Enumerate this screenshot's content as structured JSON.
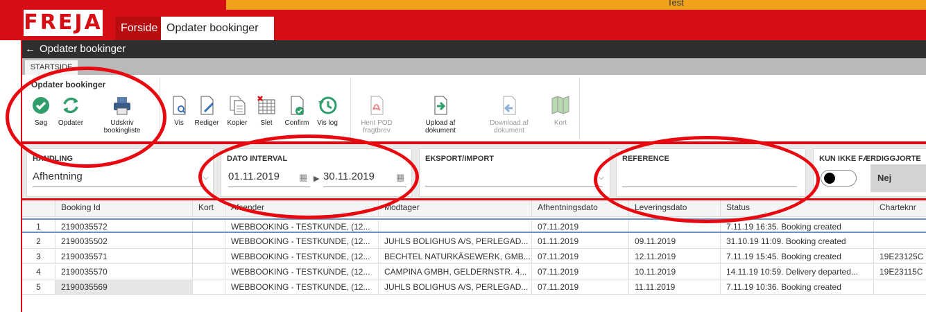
{
  "env": {
    "label": "Test"
  },
  "app": {
    "logo": "FREJA"
  },
  "app_tabs": [
    {
      "label": "Forside"
    },
    {
      "label": "Opdater bookinger"
    }
  ],
  "titlebar": {
    "back_icon": "arrow-left-icon",
    "title": "Opdater bookinger"
  },
  "ribbon": {
    "tab": "STARTSIDE",
    "group_label": "Opdater bookinger",
    "buttons": [
      {
        "label": "Søg",
        "icon": "check-circle-icon",
        "color": "#2f9e6b"
      },
      {
        "label": "Opdater",
        "icon": "refresh-icon",
        "color": "#2f9e6b"
      },
      {
        "label": "Udskriv bookingliste",
        "icon": "printer-icon"
      },
      {
        "label": "Vis",
        "icon": "document-search-icon"
      },
      {
        "label": "Rediger",
        "icon": "document-edit-icon"
      },
      {
        "label": "Kopier",
        "icon": "copy-icon"
      },
      {
        "label": "Slet",
        "icon": "table-delete-icon"
      },
      {
        "label": "Confirm",
        "icon": "document-check-icon"
      },
      {
        "label": "Vis log",
        "icon": "history-icon"
      },
      {
        "label": "Hent POD fragtbrev",
        "icon": "pdf-icon",
        "disabled": true
      },
      {
        "label": "Upload af dokument",
        "icon": "document-upload-icon"
      },
      {
        "label": "Download af dokument",
        "icon": "document-download-icon",
        "disabled": true
      },
      {
        "label": "Kort",
        "icon": "map-icon",
        "disabled": true
      }
    ]
  },
  "filters": {
    "handling": {
      "label": "HANDLING",
      "value": "Afhentning"
    },
    "dato": {
      "label": "DATO INTERVAL",
      "from": "01.11.2019",
      "to": "30.11.2019"
    },
    "eksport": {
      "label": "EKSPORT/IMPORT",
      "value": ""
    },
    "reference": {
      "label": "REFERENCE",
      "value": ""
    },
    "kun": {
      "label": "KUN IKKE FÆRDIGGJORTE",
      "value": "Nej"
    }
  },
  "grid": {
    "columns": [
      "",
      "Booking Id",
      "Kort",
      "Afsender",
      "Modtager",
      "Afhentningsdato",
      "Leveringsdato",
      "Status",
      "Charteknr"
    ],
    "rows": [
      [
        "1",
        "2190035572",
        "",
        "WEBBOOKING - TESTKUNDE, (12...",
        "",
        "07.11.2019",
        "",
        "7.11.19 16:35. Booking created",
        ""
      ],
      [
        "2",
        "2190035502",
        "",
        "WEBBOOKING - TESTKUNDE, (12...",
        "JUHLS BOLIGHUS A/S, PERLEGAD...",
        "01.11.2019",
        "09.11.2019",
        "31.10.19 11:09. Booking created",
        ""
      ],
      [
        "3",
        "2190035571",
        "",
        "WEBBOOKING - TESTKUNDE, (12...",
        "BECHTEL NATURKÄSEWERK, GMB...",
        "07.11.2019",
        "12.11.2019",
        "7.11.19 15:45. Booking created",
        "19E23125C"
      ],
      [
        "4",
        "2190035570",
        "",
        "WEBBOOKING - TESTKUNDE, (12...",
        "CAMPINA GMBH, GELDERNSTR. 4...",
        "07.11.2019",
        "10.11.2019",
        "14.11.19 10:59. Delivery departed...",
        "19E23115C"
      ],
      [
        "5",
        "2190035569",
        "",
        "WEBBOOKING - TESTKUNDE, (12...",
        "JUHLS BOLIGHUS A/S, PERLEGAD...",
        "07.11.2019",
        "11.11.2019",
        "7.11.19 10:36. Booking created",
        ""
      ]
    ]
  },
  "colors": {
    "brand_red": "#d40e14",
    "accent_orange": "#f0a21b",
    "dark_bar": "#2f2f2f",
    "annotation_red": "#e8080f"
  }
}
